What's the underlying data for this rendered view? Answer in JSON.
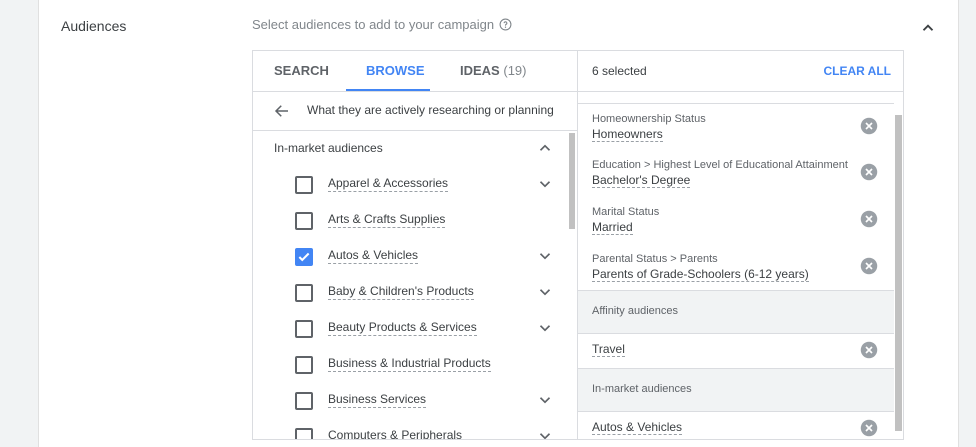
{
  "section": {
    "title": "Audiences",
    "prompt": "Select audiences to add to your campaign"
  },
  "icons": {
    "help": "help-circle-icon",
    "collapse": "chevron-up-icon",
    "back": "arrow-back-icon",
    "remove": "remove-circle-icon",
    "check": "check-icon",
    "expand": "chevron-down-icon"
  },
  "colors": {
    "accent": "#4285f4",
    "text": "#3c4043",
    "muted": "#80868b"
  },
  "tabs": {
    "search": "SEARCH",
    "browse": "BROWSE",
    "ideas": "IDEAS",
    "ideas_count": "(19)",
    "active": "BROWSE"
  },
  "breadcrumb": {
    "text": "What they are actively researching or planning"
  },
  "browse_group": {
    "title": "In-market audiences",
    "items": [
      {
        "label": "Apparel & Accessories",
        "checked": false,
        "expandable": true
      },
      {
        "label": "Arts & Crafts Supplies",
        "checked": false,
        "expandable": false
      },
      {
        "label": "Autos & Vehicles",
        "checked": true,
        "expandable": true
      },
      {
        "label": "Baby & Children's Products",
        "checked": false,
        "expandable": true
      },
      {
        "label": "Beauty Products & Services",
        "checked": false,
        "expandable": true
      },
      {
        "label": "Business & Industrial Products",
        "checked": false,
        "expandable": false
      },
      {
        "label": "Business Services",
        "checked": false,
        "expandable": true
      },
      {
        "label": "Computers & Peripherals",
        "checked": false,
        "expandable": true
      }
    ]
  },
  "selected": {
    "count_label": "6 selected",
    "clear_label": "CLEAR ALL",
    "entries": [
      {
        "category": "Homeownership Status",
        "value": "Homeowners"
      },
      {
        "category": "Education > Highest Level of Educational Attainment",
        "value": "Bachelor's Degree"
      },
      {
        "category": "Marital Status",
        "value": "Married"
      },
      {
        "category": "Parental Status > Parents",
        "value": "Parents of Grade-Schoolers (6-12 years)"
      }
    ],
    "affinity": {
      "header": "Affinity audiences",
      "entries": [
        {
          "value": "Travel"
        }
      ]
    },
    "in_market": {
      "header": "In-market audiences",
      "entries": [
        {
          "value": "Autos & Vehicles"
        }
      ]
    }
  }
}
